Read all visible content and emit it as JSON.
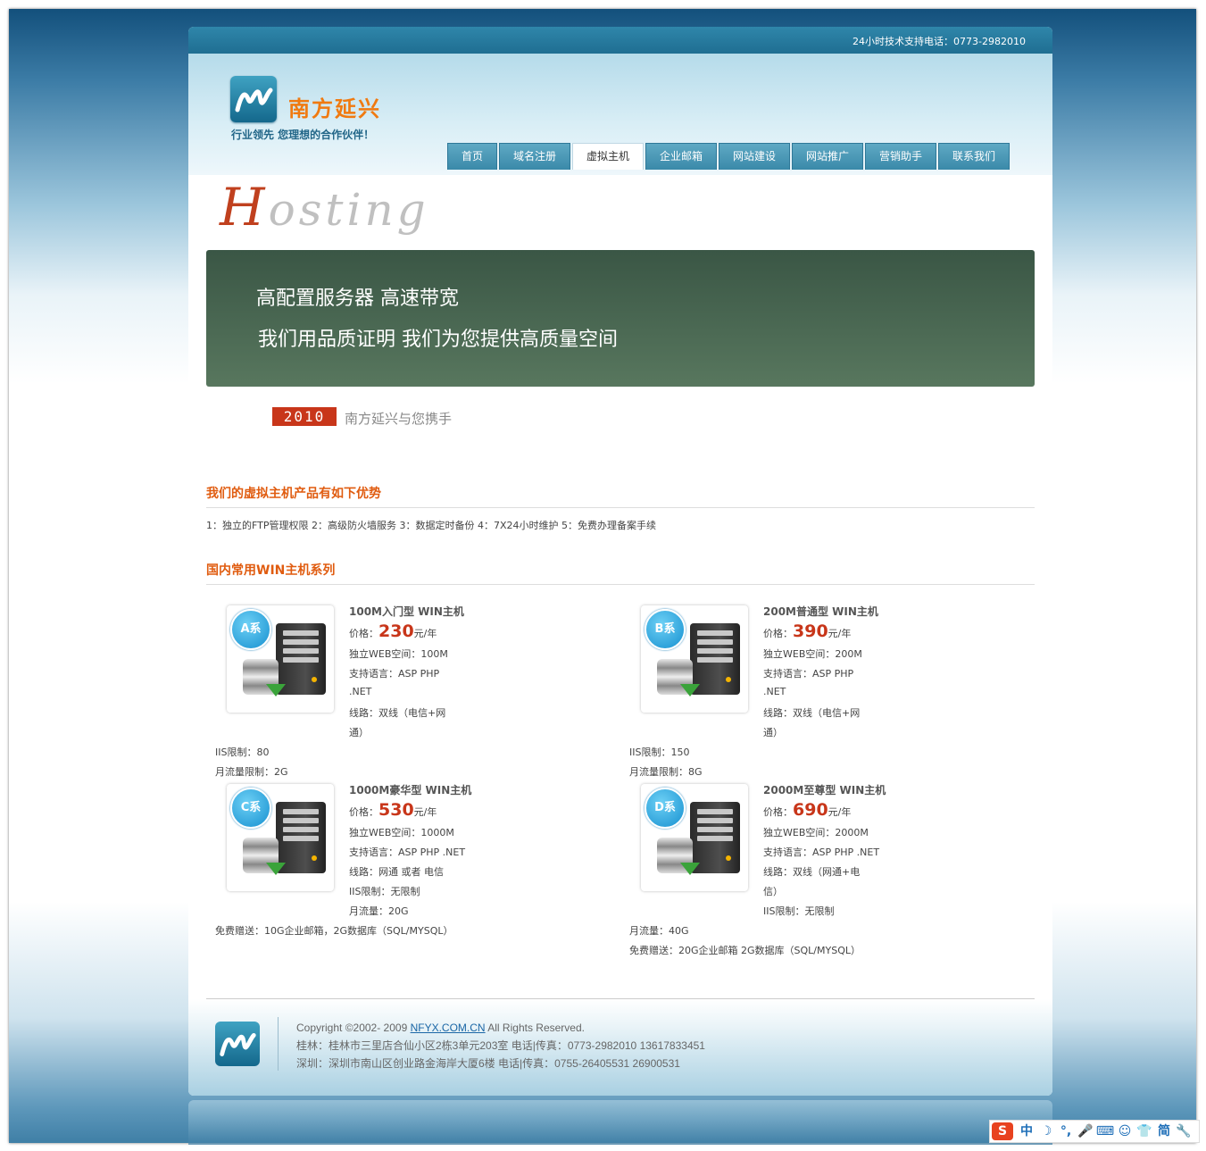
{
  "topbar": {
    "phone": "24小时技术支持电话：0773-2982010"
  },
  "brand": {
    "name": "南方延兴",
    "slogan": "行业领先  您理想的合作伙伴！"
  },
  "nav": [
    {
      "label": "首页"
    },
    {
      "label": "域名注册"
    },
    {
      "label": "虚拟主机",
      "active": true
    },
    {
      "label": "企业邮箱"
    },
    {
      "label": "网站建设"
    },
    {
      "label": "网站推广"
    },
    {
      "label": "营销助手"
    },
    {
      "label": "联系我们"
    }
  ],
  "hosting_title": {
    "first": "H",
    "rest": "osting"
  },
  "banner": {
    "line1": "高配置服务器  高速带宽",
    "line2": "我们用品质证明  我们为您提供高质量空间"
  },
  "tagline": {
    "year": "2010",
    "text": "南方延兴与您携手"
  },
  "advantages": {
    "title": "我们的虚拟主机产品有如下优势",
    "text": "1：独立的FTP管理权限  2：高级防火墙服务  3：数据定时备份  4：7X24小时维护  5：免费办理备案手续"
  },
  "series": {
    "title": "国内常用WIN主机系列",
    "products": [
      {
        "badge": "A系",
        "title": "100M入门型 WIN主机",
        "price_label": "价格：",
        "price": "230",
        "price_unit": "元/年",
        "lines": [
          "独立WEB空间：100M",
          "支持语言：ASP PHP",
          ".NET",
          "线路：双线（电信+网",
          "通）"
        ],
        "full_lines": [
          "IIS限制：80",
          "月流量限制：2G"
        ]
      },
      {
        "badge": "B系",
        "title": "200M普通型 WIN主机",
        "price_label": "价格：",
        "price": "390",
        "price_unit": "元/年",
        "lines": [
          "独立WEB空间：200M",
          "支持语言：ASP PHP",
          ".NET",
          "线路：双线（电信+网",
          "通）"
        ],
        "full_lines": [
          "IIS限制：150",
          "月流量限制：8G"
        ]
      },
      {
        "badge": "C系",
        "title": "1000M豪华型 WIN主机",
        "price_label": "价格：",
        "price": "530",
        "price_unit": "元/年",
        "lines": [
          "独立WEB空间：1000M",
          "支持语言：ASP PHP .NET",
          "线路：网通 或者 电信",
          "IIS限制：无限制",
          "月流量：20G"
        ],
        "full_lines": [
          "免费赠送：10G企业邮箱，2G数据库（SQL/MYSQL）"
        ]
      },
      {
        "badge": "D系",
        "title": "2000M至尊型 WIN主机",
        "price_label": "价格：",
        "price": "690",
        "price_unit": "元/年",
        "lines": [
          "独立WEB空间：2000M",
          "支持语言：ASP PHP .NET",
          "线路：双线（网通+电",
          "信）",
          "IIS限制：无限制"
        ],
        "full_lines": [
          "月流量：40G",
          "免费赠送：20G企业邮箱 2G数据库（SQL/MYSQL）"
        ]
      }
    ]
  },
  "footer": {
    "copyright_prefix": "Copyright ©2002- 2009 ",
    "copyright_link": "NFYX.COM.CN",
    "copyright_suffix": " All Rights Reserved.",
    "guilin": "桂林：桂林市三里店合仙小区2栋3单元203室 电话|传真：0773-2982010 13617833451",
    "shenzhen": "深圳：深圳市南山区创业路金海岸大厦6楼 电话|传真：0755-26405531 26900531"
  },
  "ime": {
    "logo": "S",
    "items": [
      "中",
      "☽",
      "°,",
      "🎤",
      "⌨",
      "☺",
      "👕",
      "简",
      "🔧"
    ]
  },
  "colors": {
    "accent": "#e05c10",
    "price": "#c8361a",
    "nav": "#3a89a9"
  }
}
